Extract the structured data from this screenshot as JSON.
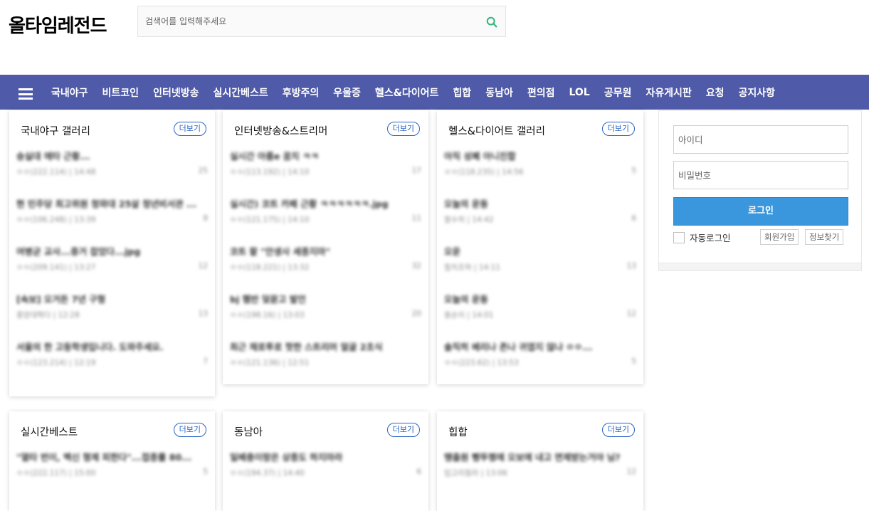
{
  "header": {
    "logo": "올타임레전드",
    "search_placeholder": "검색어를 입력해주세요"
  },
  "colors": {
    "nav_bg": "#4f5aa8",
    "accent_blue": "#2a63c2",
    "login_btn": "#3a97dd",
    "search_icon": "#2fb67c"
  },
  "nav": {
    "items": [
      "국내야구",
      "비트코인",
      "인터넷방송",
      "실시간베스트",
      "후방주의",
      "우울증",
      "헬스&다이어트",
      "힙합",
      "동남아",
      "편의점",
      "LOL",
      "공무원",
      "자유게시판",
      "요청",
      "공지사항"
    ]
  },
  "galleries": [
    {
      "title": "국내야구 갤러리",
      "more": "더보기",
      "posts": [
        {
          "title": "숭실대 에타 근황...",
          "meta": "ㅇㅇ(222.114) | 14:48",
          "comments": "25"
        },
        {
          "title": "현 민주당 최고위원 청와대 25살 청년비서관 ...",
          "meta": "ㅇㅇ(106.248) | 13:39",
          "comments": "8"
        },
        {
          "title": "여병균 교사...증거 찹았다...jpg",
          "meta": "ㅇㅇ(209.141) | 13:27",
          "comments": "12"
        },
        {
          "title": "[속보] 오거돈 7년 구형",
          "meta": "중앙대학다 | 12:28",
          "comments": "13"
        },
        {
          "title": "서울의 한 고등학생입니다. 도와주세요.",
          "meta": "ㅇㅇ(123.214) | 12:19",
          "comments": "7"
        }
      ]
    },
    {
      "title": "인터넷방송&스트리머",
      "more": "더보기",
      "posts": [
        {
          "title": "실시간 아름e 꿈치 ㅋㅋ",
          "meta": "ㅇㅇ(113.192) | 14:10",
          "comments": "17"
        },
        {
          "title": "실시간) 코트 카페 근황 ㅋㅋㅋㅋㅋㅋ.jpg",
          "meta": "ㅇㅇ(121.175) | 14:10",
          "comments": "11"
        },
        {
          "title": "코트 팥 \"안생사 세종지마\"",
          "meta": "ㅇㅇ(118.221) | 13:32",
          "comments": "32"
        },
        {
          "title": "bj 햄반 덫뮨고 발언",
          "meta": "ㅇㅇ(198.16) | 13:03",
          "comments": "20"
        },
        {
          "title": "최근 채로투로 핫한 스트리머 얼굴 2초식",
          "meta": "ㅇㅇ(121.136) | 12:51",
          "comments": ""
        }
      ]
    },
    {
      "title": "헬스&다이어트 갤러리",
      "more": "더보기",
      "posts": [
        {
          "title": "아직 성폐 아니진합",
          "meta": "ㅇㅇ(118.235) | 14:56",
          "comments": "5"
        },
        {
          "title": "오늘의 운동",
          "meta": "할수히 | 14:42",
          "comments": "6"
        },
        {
          "title": "오운",
          "meta": "힘치조하 | 14:11",
          "comments": "13"
        },
        {
          "title": "오늘의 운동",
          "meta": "몽손이 | 14:01",
          "comments": "12"
        },
        {
          "title": "솔직히 베리나 존나 귀엽지 않냐 ㅇㅇ...",
          "meta": "ㅇㅇ(223.62) | 13:53",
          "comments": "5"
        }
      ]
    },
    {
      "title": "실시간베스트",
      "more": "더보기",
      "posts": [
        {
          "title": "\"열타 번이, 백신 형제 피한다\"...접종률 80...",
          "meta": "ㅇㅇ(222.117) | 15:00",
          "comments": "5"
        }
      ]
    },
    {
      "title": "동남아",
      "more": "더보기",
      "posts": [
        {
          "title": "일베충이랑은 상종도 하지마라",
          "meta": "ㅇㅇ(194.37) | 14:40",
          "comments": "6"
        }
      ]
    },
    {
      "title": "힙합",
      "more": "더보기",
      "posts": [
        {
          "title": "땡출원 뻥뚜쩡에 오보에 내고 면제받는거야 님?",
          "meta": "입고리힐라 | 13:06",
          "comments": "12"
        }
      ]
    }
  ],
  "login": {
    "id_placeholder": "아이디",
    "pw_placeholder": "비밀번호",
    "login_button": "로그인",
    "auto_login": "자동로그인",
    "signup": "회원가입",
    "find_info": "정보찾기"
  }
}
